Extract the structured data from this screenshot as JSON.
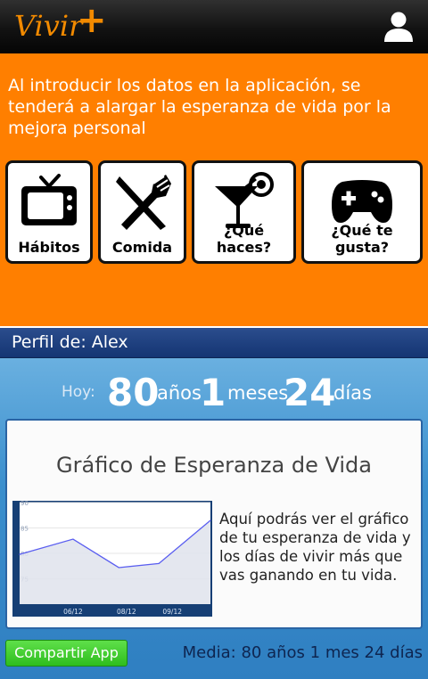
{
  "app": {
    "logo_text": "Vivir",
    "logo_plus": "+"
  },
  "intro": {
    "text": "Al introducir los datos en la aplicación, se tenderá a alargar la esperanza de vida por la mejora personal"
  },
  "categories": [
    {
      "label": "Hábitos",
      "icon": "tv-icon"
    },
    {
      "label": "Comida",
      "icon": "utensils-icon"
    },
    {
      "label": "¿Qué haces?",
      "icon": "cocktail-icon"
    },
    {
      "label": "¿Qué te gusta?",
      "icon": "gamepad-icon"
    }
  ],
  "profile": {
    "label": "Perfil de: Alex"
  },
  "age": {
    "prefix": "Hoy:",
    "years": "80",
    "years_unit": "años",
    "months": "1",
    "months_unit": "meses",
    "days": "24",
    "days_unit": "días"
  },
  "chart_card": {
    "title": "Gráfico de Esperanza de Vida",
    "description": "Aquí podrás ver el gráfico de tu esperanza de vida y los días de vivir más que vas ganando en tu vida."
  },
  "chart_data": {
    "type": "area",
    "ylim": [
      70,
      90
    ],
    "yticks": [
      "90",
      "85",
      "80",
      "75"
    ],
    "xticks": [
      "06/12",
      "08/12",
      "09/12"
    ],
    "x_positions": [
      0.28,
      0.56,
      0.8
    ],
    "points": [
      {
        "x": 0.0,
        "y": 79.8
      },
      {
        "x": 0.28,
        "y": 82.8
      },
      {
        "x": 0.52,
        "y": 77.2
      },
      {
        "x": 0.73,
        "y": 78.0
      },
      {
        "x": 1.0,
        "y": 86.5
      }
    ],
    "colors": {
      "line": "#5a5ef0",
      "area": "#dfe3ec",
      "frame": "#163f75"
    }
  },
  "footer": {
    "share_label": "Compartir App",
    "media_text": "Media: 80 años 1 mes 24 días"
  },
  "colors": {
    "accent": "#ff7f00",
    "profile_bar": "#1e3f7e",
    "share_button": "#3dc62a"
  }
}
